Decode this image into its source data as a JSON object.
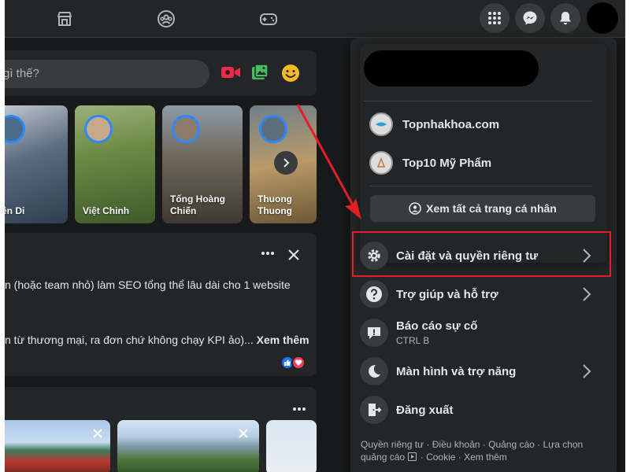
{
  "composer": {
    "placeholder": "gì thế?"
  },
  "stories": [
    {
      "name": "ên Di"
    },
    {
      "name": "Việt Chinh"
    },
    {
      "name": "Tống Hoàng Chiến"
    },
    {
      "name": "Thuong Thuong"
    }
  ],
  "post": {
    "line1": "n (hoặc team nhỏ) làm SEO tổng thể lâu dài cho 1 website",
    "line2": "n từ thương mại, ra đơn chứ không chạy KPI ảo)...",
    "see_more": "Xem thêm"
  },
  "menu": {
    "pages": [
      {
        "name": "Topnhakhoa.com"
      },
      {
        "name": "Top10 Mỹ Phẩm"
      }
    ],
    "see_all": "Xem tất cả trang cá nhân",
    "items": [
      {
        "label": "Cài đặt và quyền riêng tư",
        "icon": "gear-icon"
      },
      {
        "label": "Trợ giúp và hỗ trợ",
        "icon": "question-icon"
      },
      {
        "label": "Báo cáo sự cố",
        "sub": "CTRL B",
        "icon": "report-icon"
      },
      {
        "label": "Màn hình và trợ năng",
        "icon": "moon-icon"
      },
      {
        "label": "Đăng xuất",
        "icon": "logout-icon"
      }
    ],
    "footer": {
      "line1": "Quyền riêng tư · Điều khoản · Quảng cáo · Lựa chọn",
      "line2a": "quảng cáo",
      "line2b": "· Cookie · Xem thêm"
    }
  },
  "colors": {
    "accent": "#2d88ff",
    "highlight": "#e41e26",
    "background": "#18191a",
    "surface": "#242526"
  }
}
